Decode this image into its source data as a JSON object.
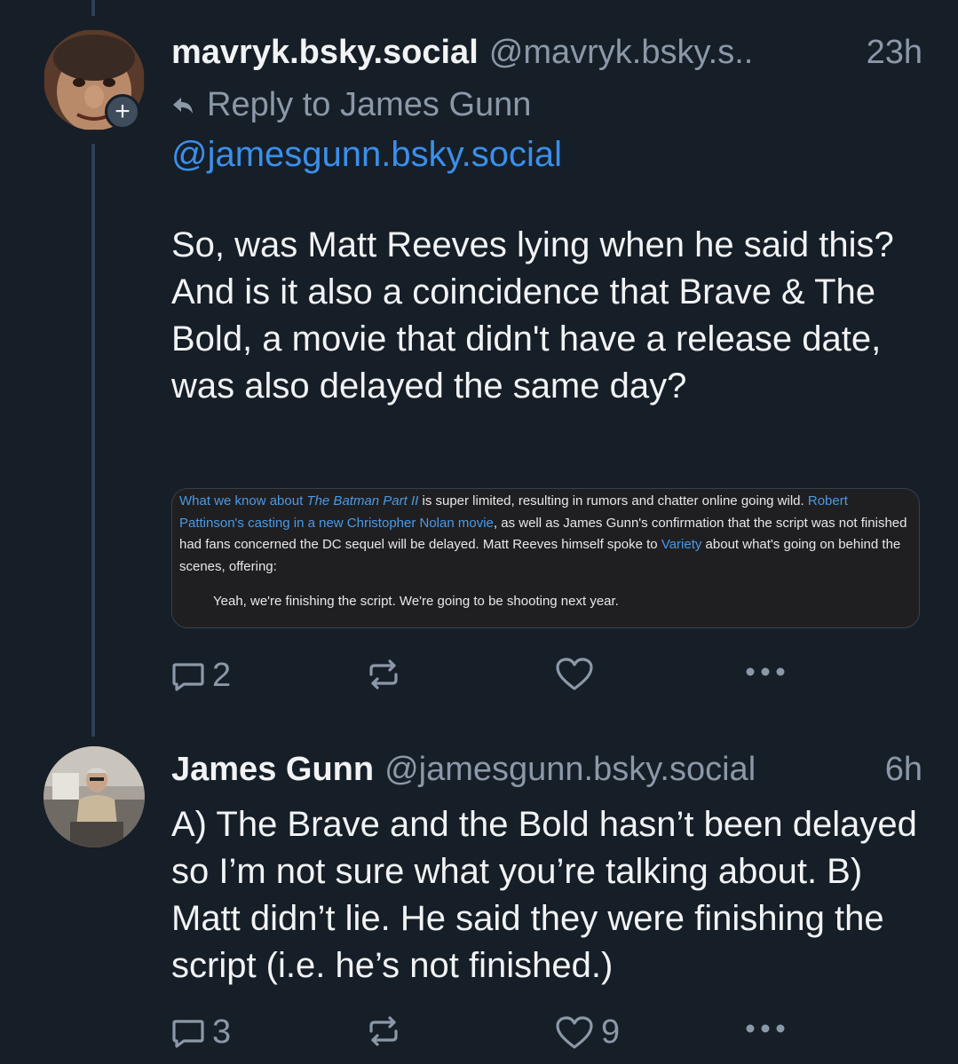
{
  "thread": {
    "posts": [
      {
        "display_name": "mavryk.bsky.social",
        "handle": "@mavryk.bsky.s..",
        "time": "23h",
        "reply_to": "Reply to James Gunn",
        "mention": "@jamesgunn.bsky.social",
        "text": "So, was Matt Reeves lying when he said this? And is it also a coincidence that Brave & The Bold, a movie that didn't have a release date, was also delayed the same day?",
        "quote_image": {
          "p1": "What we know about ",
          "p1_link_italic": "The Batman Part II",
          "p2": " is super limited, resulting in rumors and chatter online going wild. ",
          "p2_link": "Robert Pattinson's casting in a new Christopher Nolan movie",
          "p3": ", as well as James Gunn's confirmation that the script was not finished had fans concerned the DC sequel will be delayed. Matt Reeves himself spoke to ",
          "p3_link": "Variety",
          "p4": " about what's going on behind the scenes, offering:",
          "blockquote": "Yeah, we're finishing the script. We're going to be shooting next year."
        },
        "actions": {
          "replies": "2",
          "reposts": "",
          "likes": "",
          "more": "more-options-icon"
        }
      },
      {
        "display_name": "James Gunn",
        "handle": "@jamesgunn.bsky.social",
        "time": "6h",
        "text": "A) The Brave and the Bold hasn’t been delayed so I’m not sure what you’re talking about. B) Matt didn’t lie. He said they were finishing the script (i.e. he’s not finished.)",
        "actions": {
          "replies": "3",
          "reposts": "",
          "likes": "9",
          "more": "more-options-icon"
        }
      }
    ]
  },
  "colors": {
    "background": "#161e27",
    "text": "#f1f3f5",
    "muted": "#8b98a8",
    "link": "#3b8fea",
    "thread_line": "#2e4052"
  }
}
